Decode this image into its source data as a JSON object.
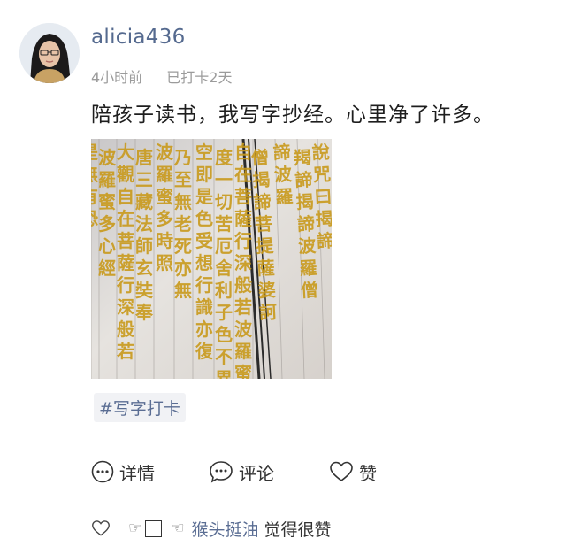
{
  "post": {
    "username": "alicia436",
    "time_ago": "4小时前",
    "checkin_status": "已打卡2天",
    "text": "陪孩子读书，我写字抄经。心里净了许多。",
    "hashtag": "#写字打卡"
  },
  "actions": {
    "details_label": "详情",
    "comment_label": "评论",
    "like_label": "赞"
  },
  "likes": {
    "liker_name": "猴头挺油",
    "suffix": "觉得很赞"
  },
  "photo": {
    "columns": [
      "是無有恐",
      "波羅蜜多心經",
      "大觀自在菩薩行深般若",
      "唐三藏法師玄奘奉",
      "波羅蜜多時照",
      "乃至無老死亦無",
      "空即是色受想行識亦復",
      "度一切苦厄舍利子色不異空",
      "自在菩薩行深般若波羅蜜多",
      "僧揭諦菩提薩婆訶",
      "諦波羅",
      "羯諦揭諦波羅僧",
      "說咒曰揭諦"
    ],
    "ink_color": "#c99a1c",
    "paper_color": "#e4e1dd",
    "binding_color": "#2b2b2b"
  },
  "colors": {
    "username": "#556a8f",
    "link": "#5a6d93",
    "meta": "#9b9b9b"
  }
}
